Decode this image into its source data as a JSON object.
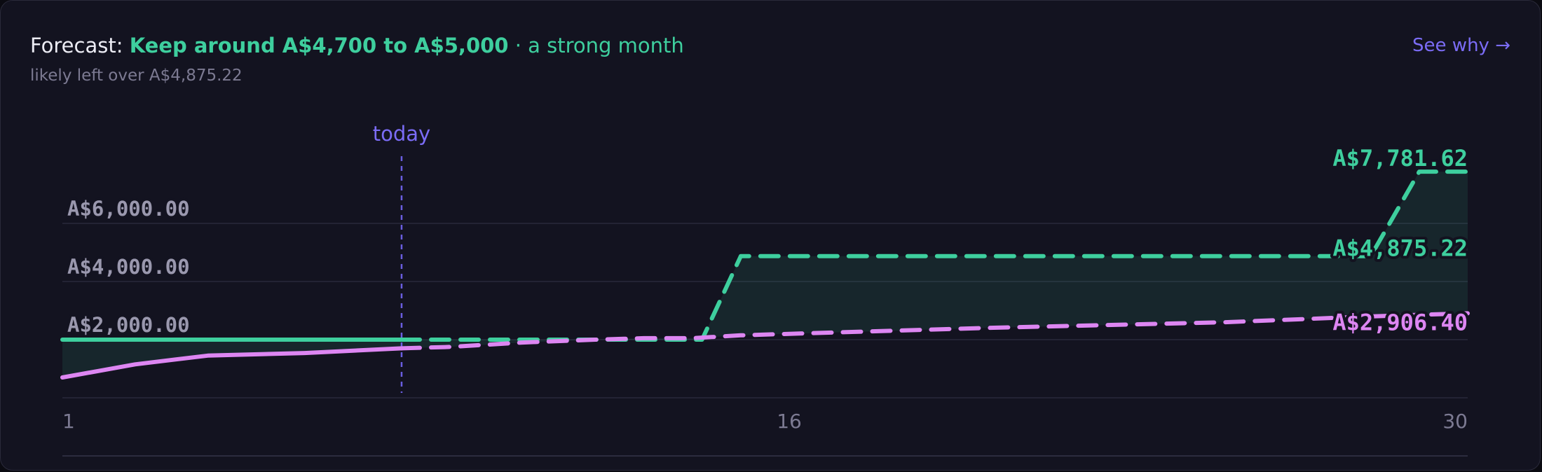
{
  "header": {
    "prefix": "Forecast: ",
    "highlight": "Keep around A$4,700 to A$5,000",
    "suffix": " · a strong month",
    "subtitle": "likely left over A$4,875.22",
    "link": "See why →"
  },
  "colors": {
    "accent_green": "#3ecf9e",
    "accent_pink": "#dd86f2",
    "accent_violet": "#7b6cf6",
    "muted": "#7c7a92"
  },
  "chart_data": {
    "type": "line",
    "title": "",
    "xlabel": "",
    "ylabel": "",
    "xlim": [
      1,
      30
    ],
    "ylim": [
      -3000,
      8200
    ],
    "x_ticks": [
      "1",
      "16",
      "30"
    ],
    "y_ticks": [
      {
        "value": 6000,
        "label": "A$6,000.00"
      },
      {
        "value": 4000,
        "label": "A$4,000.00"
      },
      {
        "value": 2000,
        "label": "A$2,000.00"
      }
    ],
    "gridlines": [
      6000,
      4000,
      2000,
      0,
      -2000
    ],
    "grid": true,
    "today": {
      "x": 8,
      "label": "today"
    },
    "series": [
      {
        "key": "balance_actual",
        "color": "#3ecf9e",
        "style": "solid",
        "x": [
          1,
          8
        ],
        "y": [
          2000,
          2000
        ]
      },
      {
        "key": "balance_forecast",
        "color": "#3ecf9e",
        "style": "dashed",
        "x": [
          8,
          14.2,
          15,
          28,
          29,
          30
        ],
        "y": [
          2000,
          2000,
          4875.22,
          4875.22,
          7781.62,
          7781.62
        ]
      },
      {
        "key": "spend_actual",
        "color": "#dd86f2",
        "style": "solid",
        "x": [
          1,
          2.5,
          4,
          6,
          8
        ],
        "y": [
          700,
          1150,
          1450,
          1540,
          1700
        ]
      },
      {
        "key": "spend_forecast",
        "color": "#dd86f2",
        "style": "dashed",
        "x": [
          8,
          9,
          10.5,
          12,
          13,
          14,
          15,
          20,
          25,
          28,
          30
        ],
        "y": [
          1700,
          1750,
          1900,
          2000,
          2050,
          2050,
          2150,
          2400,
          2600,
          2800,
          2906.4
        ]
      }
    ],
    "end_labels": [
      {
        "label": "A$7,781.62",
        "value": 7781.62,
        "color": "#3ecf9e"
      },
      {
        "label": "A$4,875.22",
        "value": 4875.22,
        "color": "#3ecf9e"
      },
      {
        "label": "A$2,906.40",
        "value": 2906.4,
        "color": "#dd86f2"
      }
    ]
  }
}
